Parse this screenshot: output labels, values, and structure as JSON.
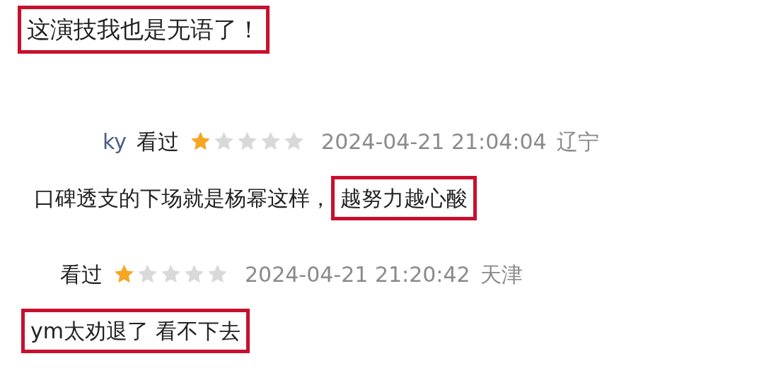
{
  "headline": {
    "text": "这演技我也是无语了！",
    "highlighted": true
  },
  "comments": [
    {
      "user": "ky",
      "status": "看过",
      "stars": 1,
      "time": "2024-04-21 21:04:04",
      "location": "辽宁",
      "parts": [
        {
          "text": "口碑透支的下场就是杨幂这样，",
          "highlighted": false
        },
        {
          "text": "越努力越心酸",
          "highlighted": true
        }
      ]
    },
    {
      "status": "看过",
      "stars": 1,
      "time": "2024-04-21 21:20:42",
      "location": "天津",
      "parts": [
        {
          "text": "ym太劝退了 看不下去",
          "highlighted": true
        }
      ]
    }
  ]
}
